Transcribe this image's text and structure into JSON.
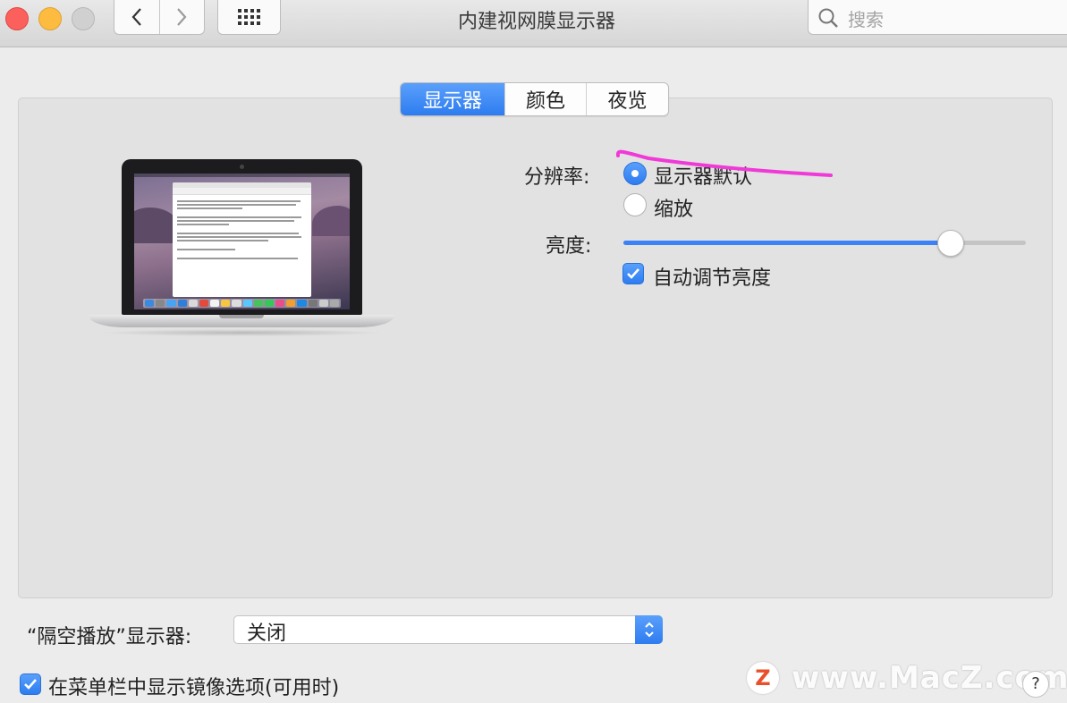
{
  "window": {
    "title": "内建视网膜显示器",
    "search_placeholder": "搜索"
  },
  "tabs": [
    {
      "label": "显示器",
      "active": true
    },
    {
      "label": "颜色",
      "active": false
    },
    {
      "label": "夜览",
      "active": false
    }
  ],
  "resolution": {
    "label": "分辨率:",
    "options": [
      {
        "label": "显示器默认",
        "selected": true
      },
      {
        "label": "缩放",
        "selected": false
      }
    ]
  },
  "brightness": {
    "label": "亮度:",
    "level": 0.81,
    "auto_label": "自动调节亮度",
    "auto_checked": true
  },
  "airplay": {
    "label": "“隔空播放”显示器:",
    "value": "关闭"
  },
  "mirroring": {
    "label": "在菜单栏中显示镜像选项(可用时)",
    "checked": true
  },
  "watermark": {
    "text": "www.MacZ.com",
    "logo_letter": "Z"
  },
  "help_label": "?",
  "colors": {
    "accent": "#2d7cf0",
    "annotation": "#f03ad8"
  }
}
